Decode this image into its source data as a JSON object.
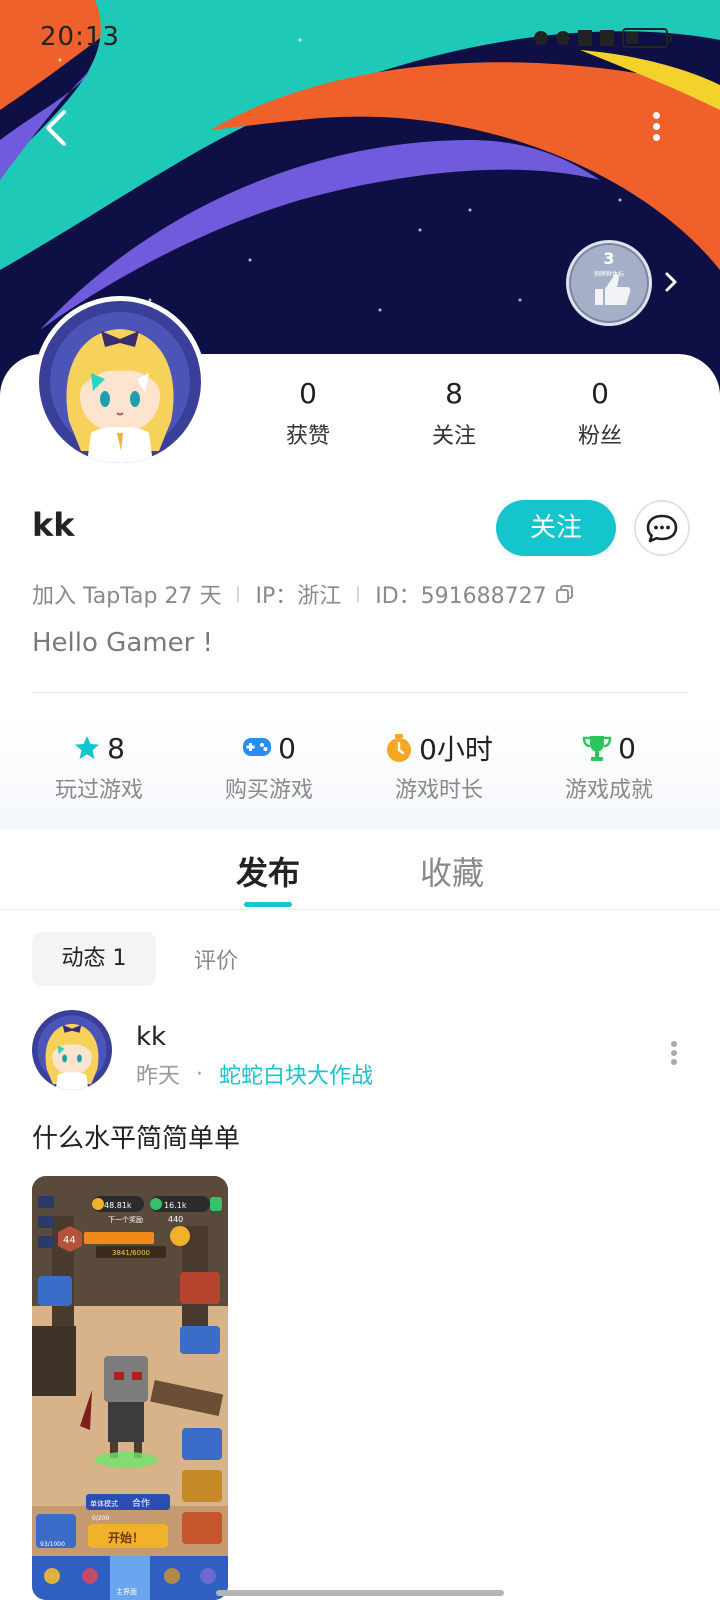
{
  "status_bar": {
    "time": "20:13"
  },
  "header": {
    "back_icon": "chevron-left-icon",
    "more_icon": "vertical-dots-icon",
    "badge": {
      "level": "3",
      "caption": "铜牌群体标",
      "icon": "thumbs-up-icon"
    }
  },
  "profile": {
    "stats": [
      {
        "value": "0",
        "label": "获赞"
      },
      {
        "value": "8",
        "label": "关注"
      },
      {
        "value": "0",
        "label": "粉丝"
      }
    ],
    "username": "kk",
    "follow_label": "关注",
    "message_icon": "chat-bubble-icon",
    "joined": "加入 TapTap 27 天",
    "ip": "IP：浙江",
    "id": "ID：591688727",
    "bio": "Hello Gamer !"
  },
  "achievements": [
    {
      "icon": "star-icon",
      "color": "#15c5ce",
      "value": "8",
      "label": "玩过游戏"
    },
    {
      "icon": "gamepad-icon",
      "color": "#2a8cf0",
      "value": "0",
      "label": "购买游戏"
    },
    {
      "icon": "stopwatch-icon",
      "color": "#f5a623",
      "value": "0小时",
      "label": "游戏时长"
    },
    {
      "icon": "trophy-icon",
      "color": "#2cc45d",
      "value": "0",
      "label": "游戏成就"
    }
  ],
  "tabs": [
    {
      "label": "发布",
      "active": true
    },
    {
      "label": "收藏",
      "active": false
    }
  ],
  "subtabs": [
    {
      "label": "动态 1",
      "active": true
    },
    {
      "label": "评价",
      "active": false
    }
  ],
  "post": {
    "author": "kk",
    "time": "昨天",
    "separator": "·",
    "game": "蛇蛇白块大作战",
    "text": "什么水平简简单单",
    "image": {
      "coins": "48.81k",
      "gems": "16.1k",
      "next_reward": "下一个奖励",
      "score": "440",
      "level": "44",
      "trophy": "3841/6000",
      "start": "开始！",
      "coop": "合作",
      "mode": "单体模式",
      "progress": "0/200",
      "bottom_progress": "93/1000",
      "rank": "主界面"
    }
  },
  "colors": {
    "accent": "#15c5ce",
    "banner_bg": "#0d0f45",
    "banner_teal": "#1ec9b7",
    "banner_orange": "#f0602a",
    "banner_purple": "#6f5bdc",
    "banner_yellow": "#f3d22b"
  }
}
